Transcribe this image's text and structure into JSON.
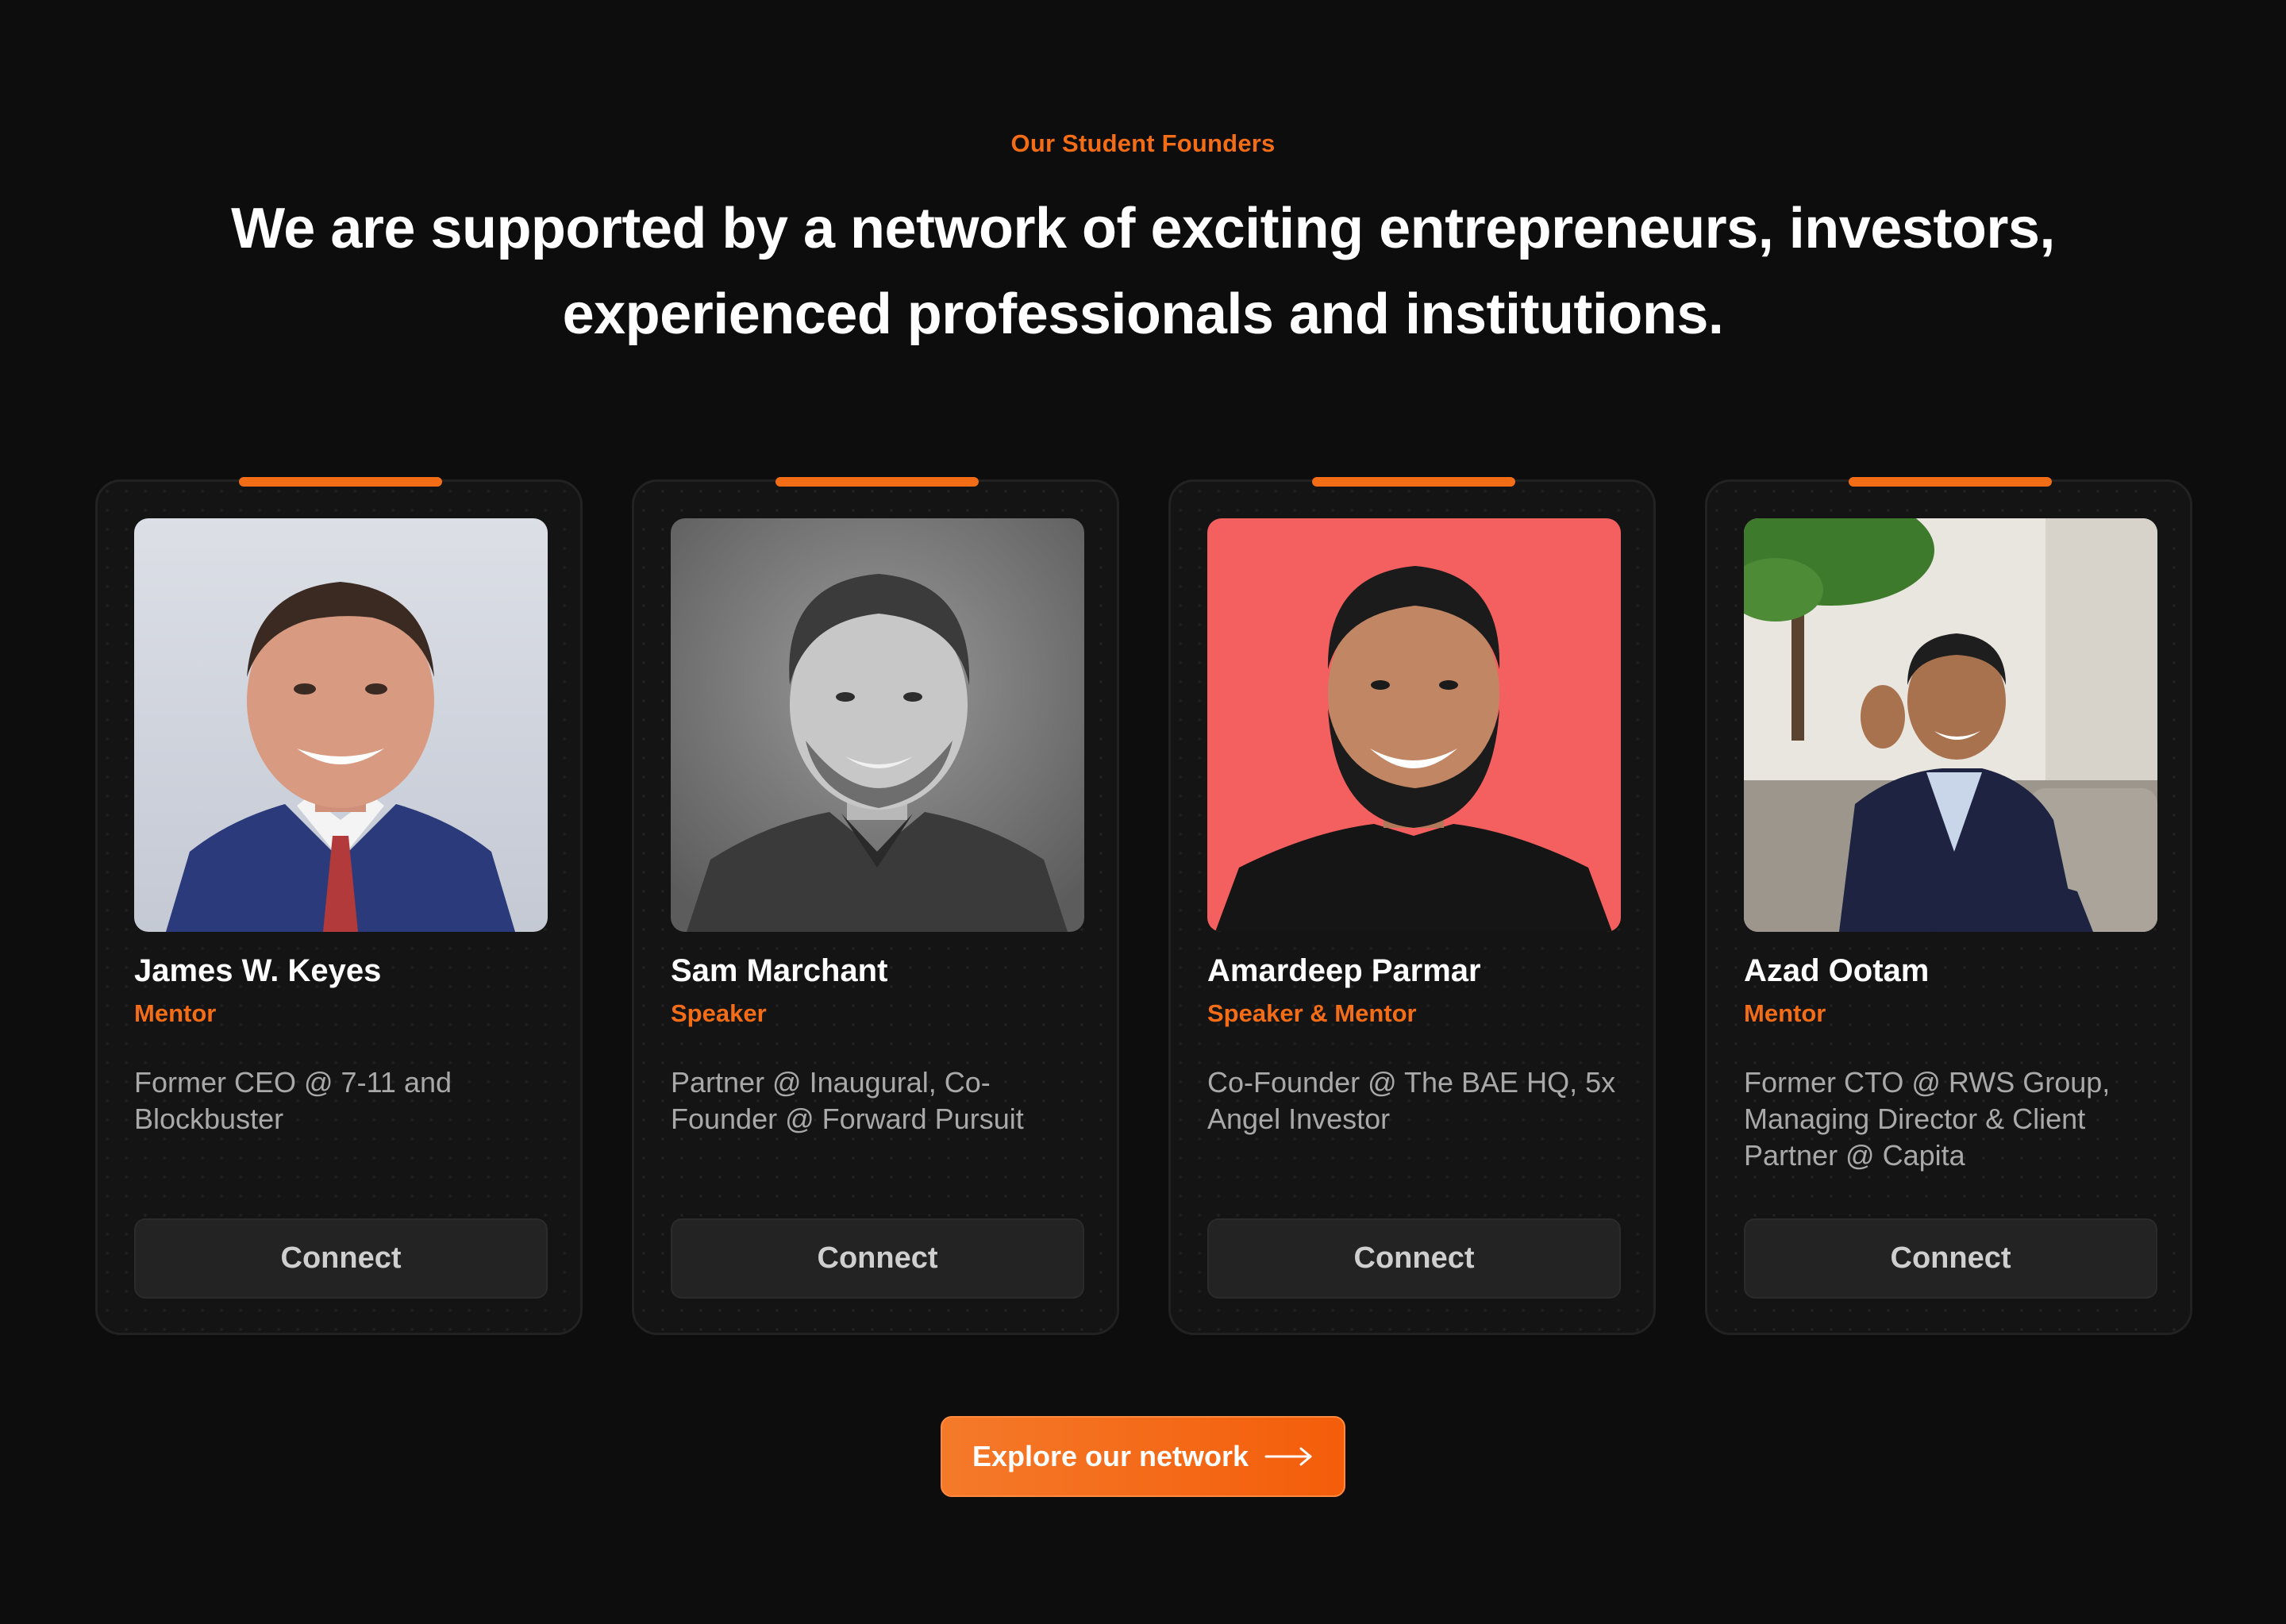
{
  "section": {
    "eyebrow": "Our Student Founders",
    "headline_line1": "We are supported by a network of exciting entrepreneurs, investors,",
    "headline_line2": "experienced professionals and institutions."
  },
  "colors": {
    "accent": "#f36c16",
    "background": "#0d0d0d",
    "card": "#141414",
    "button": "#232323"
  },
  "cards": [
    {
      "name": "James W. Keyes",
      "role": "Mentor",
      "bio": "Former CEO @ 7-11 and Blockbuster",
      "button_label": "Connect"
    },
    {
      "name": "Sam Marchant",
      "role": "Speaker",
      "bio": "Partner @ Inaugural, Co-Founder @ Forward Pursuit",
      "button_label": "Connect"
    },
    {
      "name": "Amardeep Parmar",
      "role": "Speaker & Mentor",
      "bio": "Co-Founder @ The BAE HQ, 5x Angel Investor",
      "button_label": "Connect"
    },
    {
      "name": "Azad Ootam",
      "role": "Mentor",
      "bio": "Former CTO @ RWS Group, Managing Director & Client Partner @ Capita",
      "button_label": "Connect"
    }
  ],
  "cta": {
    "label": "Explore our network",
    "icon": "arrow-right-icon"
  }
}
